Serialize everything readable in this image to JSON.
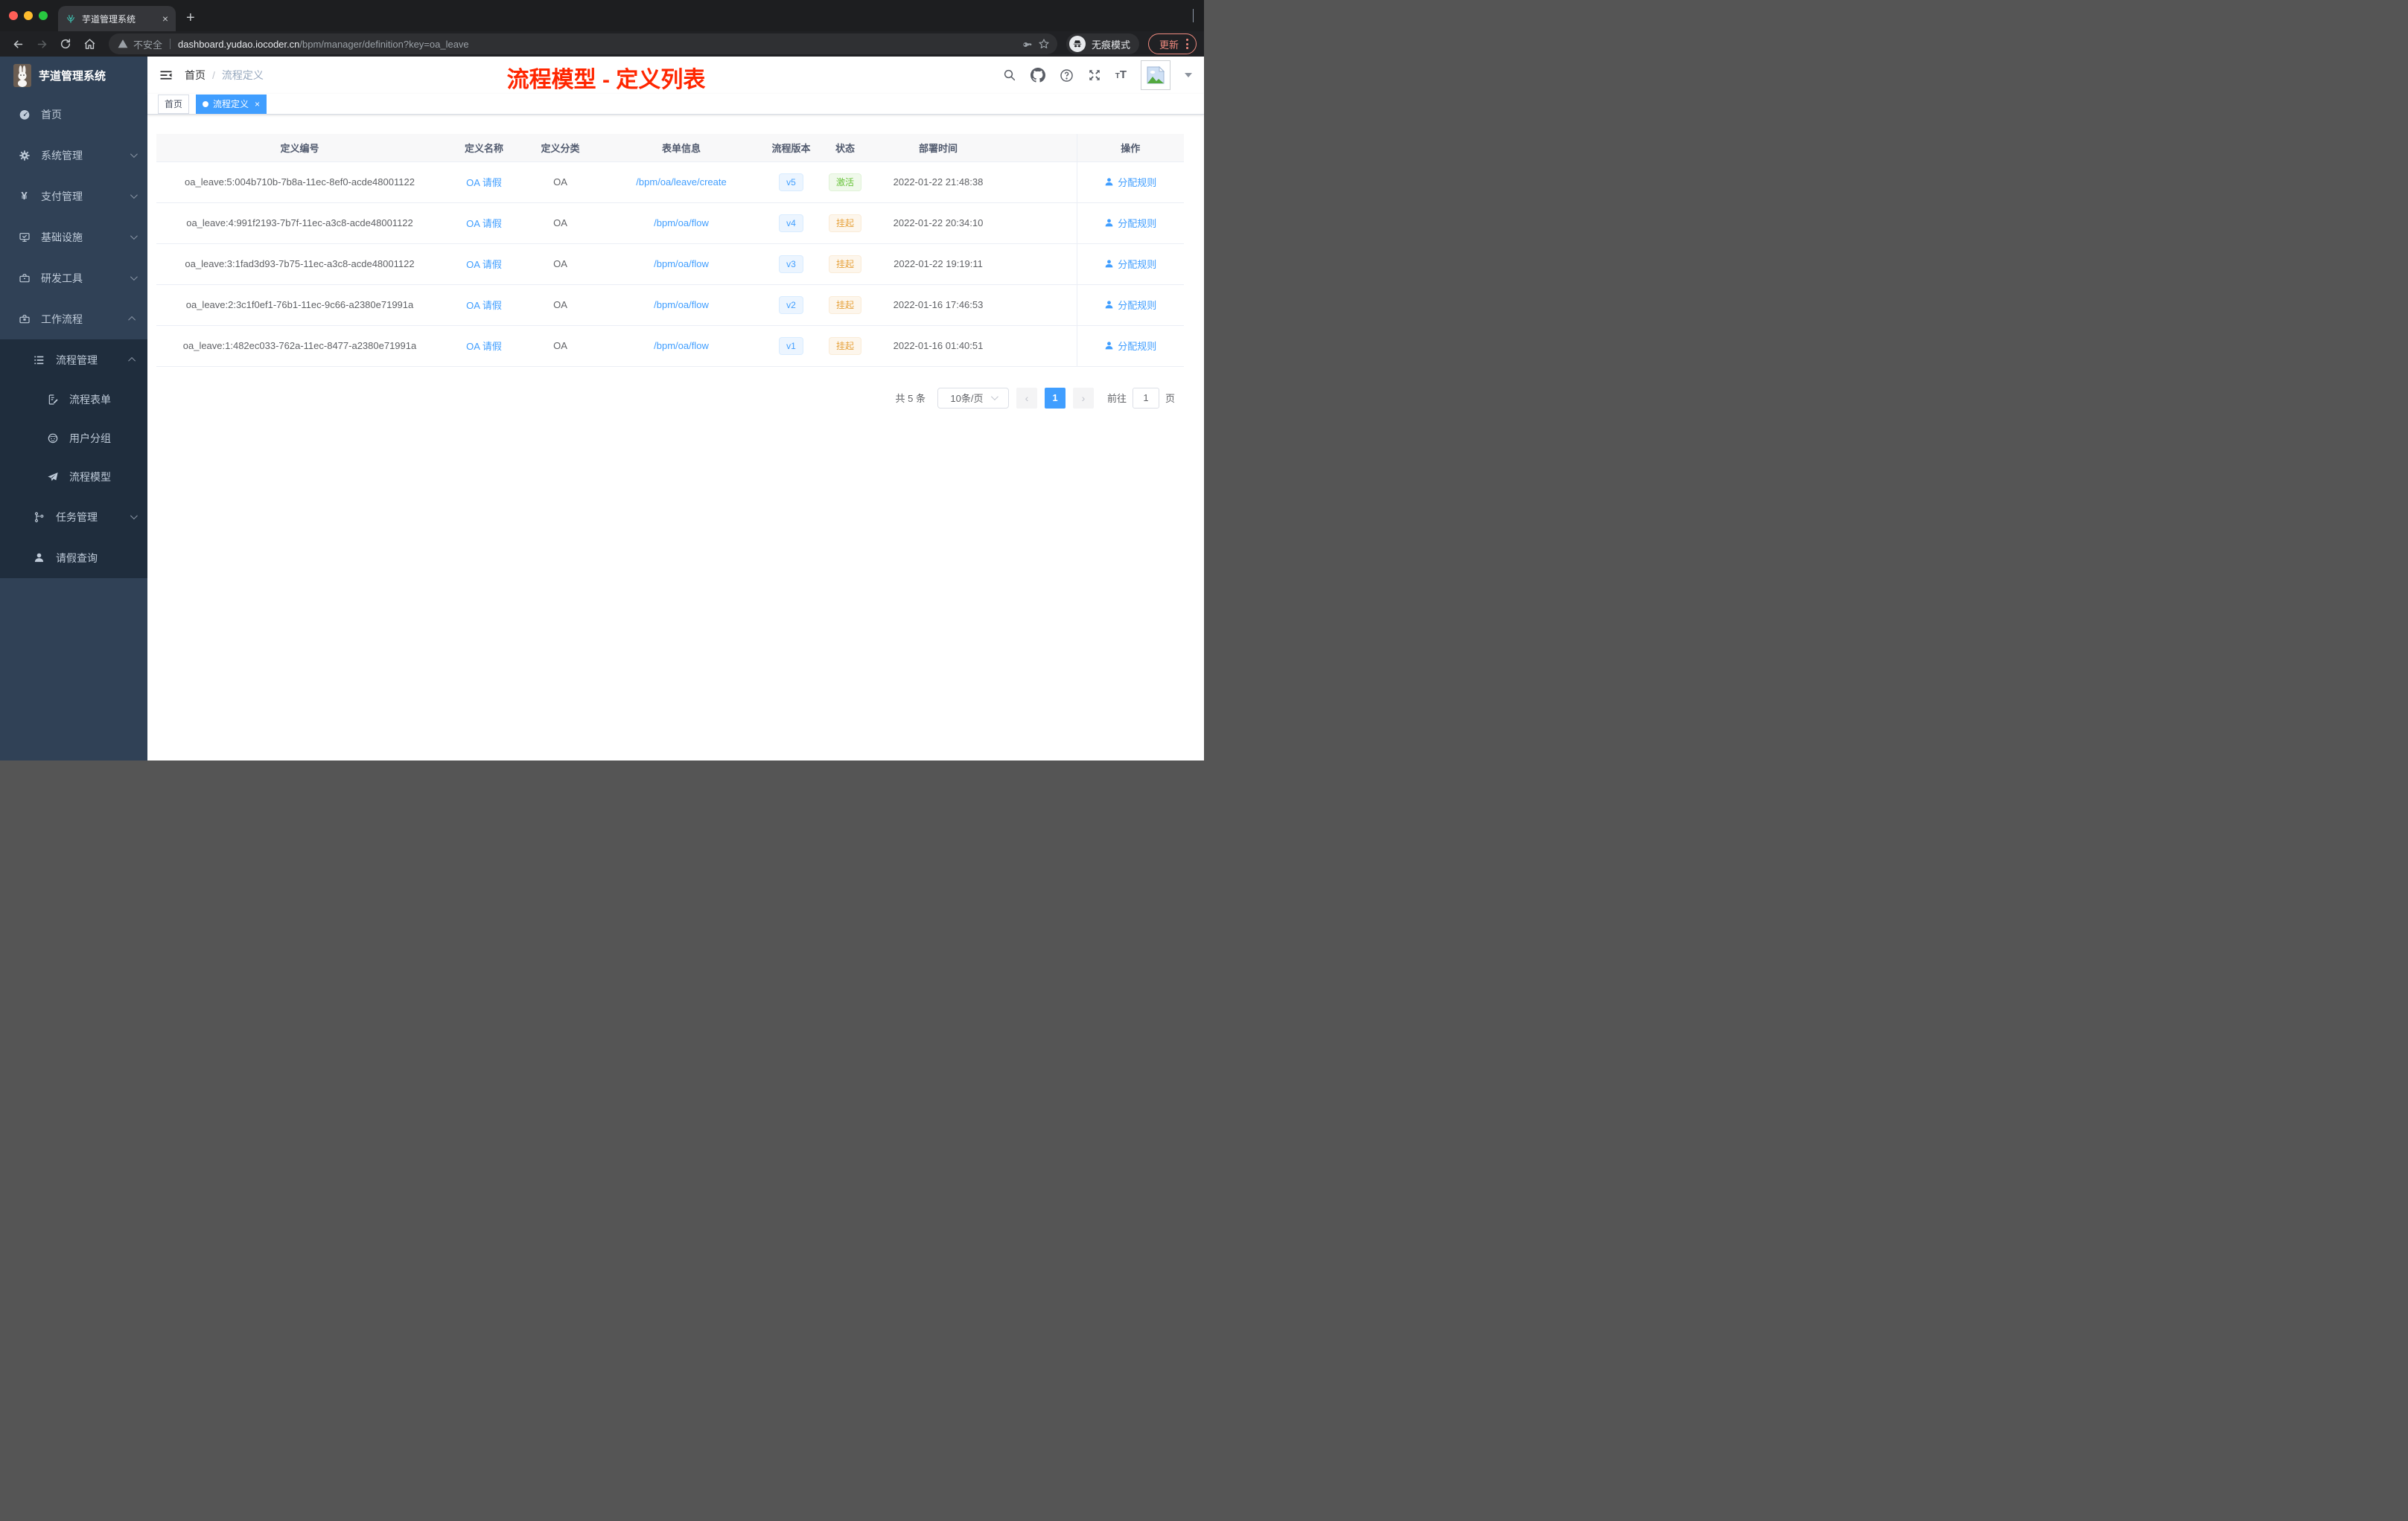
{
  "browser": {
    "tab": {
      "title": "芋道管理系统",
      "close": "×",
      "new_tab": "+"
    },
    "nav": {
      "security_label": "不安全",
      "url_domain": "dashboard.yudao.iocoder.cn",
      "url_path": "/bpm/manager/definition?key=oa_leave",
      "incognito_label": "无痕模式",
      "update_label": "更新"
    }
  },
  "sidebar": {
    "logo_title": "芋道管理系统",
    "items": [
      {
        "label": "首页"
      },
      {
        "label": "系统管理"
      },
      {
        "label": "支付管理"
      },
      {
        "label": "基础设施"
      },
      {
        "label": "研发工具"
      },
      {
        "label": "工作流程"
      },
      {
        "label": "流程管理"
      },
      {
        "label": "流程表单"
      },
      {
        "label": "用户分组"
      },
      {
        "label": "流程模型"
      },
      {
        "label": "任务管理"
      },
      {
        "label": "请假查询"
      }
    ]
  },
  "header": {
    "breadcrumb": {
      "home": "首页",
      "separator": "/",
      "current": "流程定义"
    },
    "annotation": "流程模型 - 定义列表"
  },
  "tags_view": {
    "home": "首页",
    "active": "流程定义",
    "close": "×"
  },
  "table": {
    "columns": {
      "id": "定义编号",
      "name": "定义名称",
      "category": "定义分类",
      "form": "表单信息",
      "version": "流程版本",
      "status": "状态",
      "deploy_time": "部署时间",
      "actions": "操作"
    },
    "action_label": "分配规则",
    "rows": [
      {
        "id": "oa_leave:5:004b710b-7b8a-11ec-8ef0-acde48001122",
        "name": "OA 请假",
        "category": "OA",
        "form": "/bpm/oa/leave/create",
        "version": "v5",
        "status": "激活",
        "deploy_time": "2022-01-22 21:48:38"
      },
      {
        "id": "oa_leave:4:991f2193-7b7f-11ec-a3c8-acde48001122",
        "name": "OA 请假",
        "category": "OA",
        "form": "/bpm/oa/flow",
        "version": "v4",
        "status": "挂起",
        "deploy_time": "2022-01-22 20:34:10"
      },
      {
        "id": "oa_leave:3:1fad3d93-7b75-11ec-a3c8-acde48001122",
        "name": "OA 请假",
        "category": "OA",
        "form": "/bpm/oa/flow",
        "version": "v3",
        "status": "挂起",
        "deploy_time": "2022-01-22 19:19:11"
      },
      {
        "id": "oa_leave:2:3c1f0ef1-76b1-11ec-9c66-a2380e71991a",
        "name": "OA 请假",
        "category": "OA",
        "form": "/bpm/oa/flow",
        "version": "v2",
        "status": "挂起",
        "deploy_time": "2022-01-16 17:46:53"
      },
      {
        "id": "oa_leave:1:482ec033-762a-11ec-8477-a2380e71991a",
        "name": "OA 请假",
        "category": "OA",
        "form": "/bpm/oa/flow",
        "version": "v1",
        "status": "挂起",
        "deploy_time": "2022-01-16 01:40:51"
      }
    ]
  },
  "pagination": {
    "total": "共 5 条",
    "page_size": "10条/页",
    "page": "1",
    "goto_label": "前往",
    "goto_value": "1",
    "unit_label": "页"
  },
  "colors": {
    "accent": "#409eff",
    "annotation_red": "#ff2600",
    "sidebar": "#304156",
    "sidebar_submenu": "#1f2d3d",
    "status_active": "#67c23a",
    "status_suspended": "#e6a23c",
    "update_salmon": "#ef8a7f"
  }
}
